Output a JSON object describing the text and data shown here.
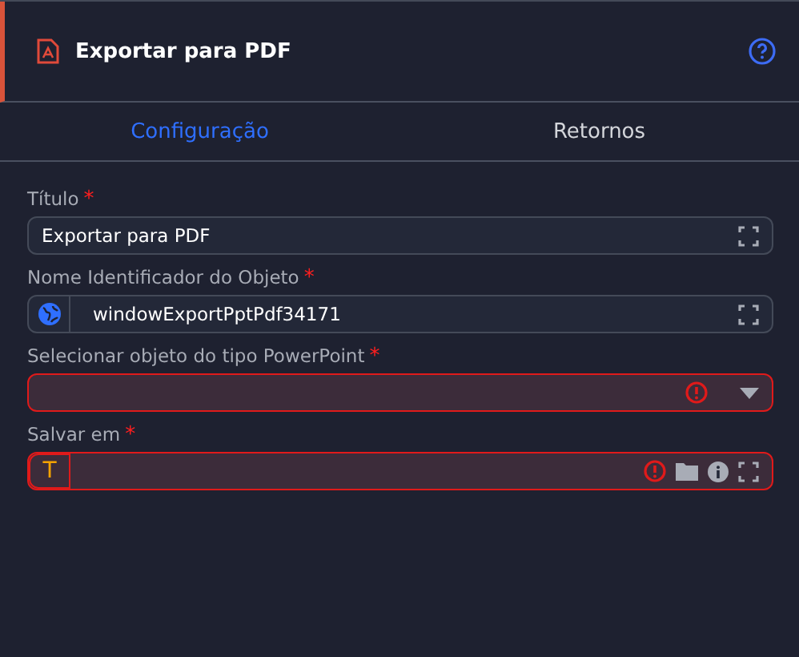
{
  "header": {
    "title": "Exportar para PDF"
  },
  "tabs": [
    {
      "label": "Configuração",
      "selected": true
    },
    {
      "label": "Retornos",
      "selected": false
    }
  ],
  "fields": [
    {
      "kind": "text",
      "label": "Título",
      "required_mark": "*",
      "value": "Exportar para PDF",
      "error": false,
      "actions": [
        {
          "kind": "expand"
        }
      ]
    },
    {
      "kind": "text",
      "label": "Nome Identificador do Objeto",
      "required_mark": "*",
      "value": "windowExportPptPdf34171",
      "error": false,
      "prefix": {
        "kind": "globe"
      },
      "actions": [
        {
          "kind": "expand"
        }
      ]
    },
    {
      "kind": "select",
      "label": "Selecionar objeto do tipo PowerPoint",
      "required_mark": "*",
      "error": true
    },
    {
      "kind": "text",
      "label": "Salvar em",
      "required_mark": "*",
      "error": true,
      "prefix": {
        "kind": "text",
        "text": "T"
      },
      "actions": [
        {
          "kind": "folder"
        },
        {
          "kind": "info"
        },
        {
          "kind": "expand"
        }
      ]
    }
  ]
}
